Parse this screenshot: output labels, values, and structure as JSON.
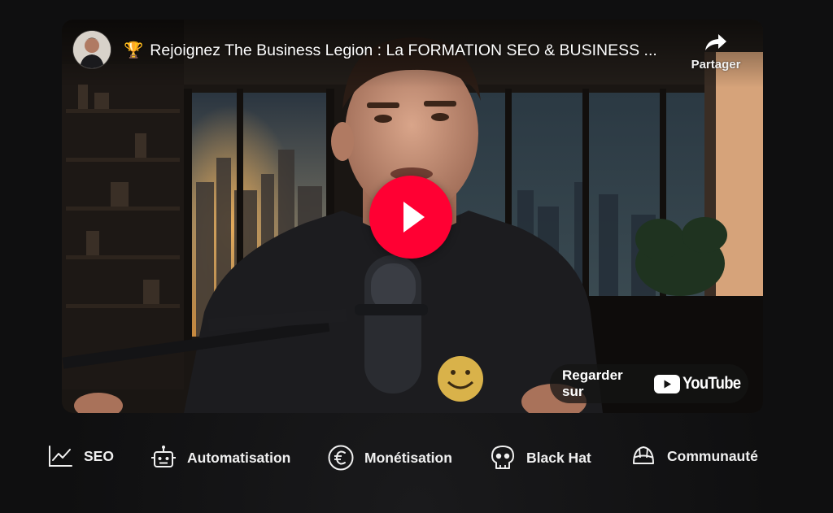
{
  "video": {
    "title": "Rejoignez The Business Legion : La FORMATION SEO & BUSINESS ...",
    "title_emoji": "🏆",
    "share_label": "Partager",
    "watch_on_label": "Regarder sur",
    "youtube_wordmark": "YouTube",
    "play_button_color": "#ff0033"
  },
  "categories": [
    {
      "label": "SEO",
      "icon": "line-chart-icon"
    },
    {
      "label": "Automatisation",
      "icon": "robot-icon"
    },
    {
      "label": "Monétisation",
      "icon": "euro-icon"
    },
    {
      "label": "Black Hat",
      "icon": "skull-icon"
    },
    {
      "label": "Communauté",
      "icon": "community-icon"
    }
  ]
}
